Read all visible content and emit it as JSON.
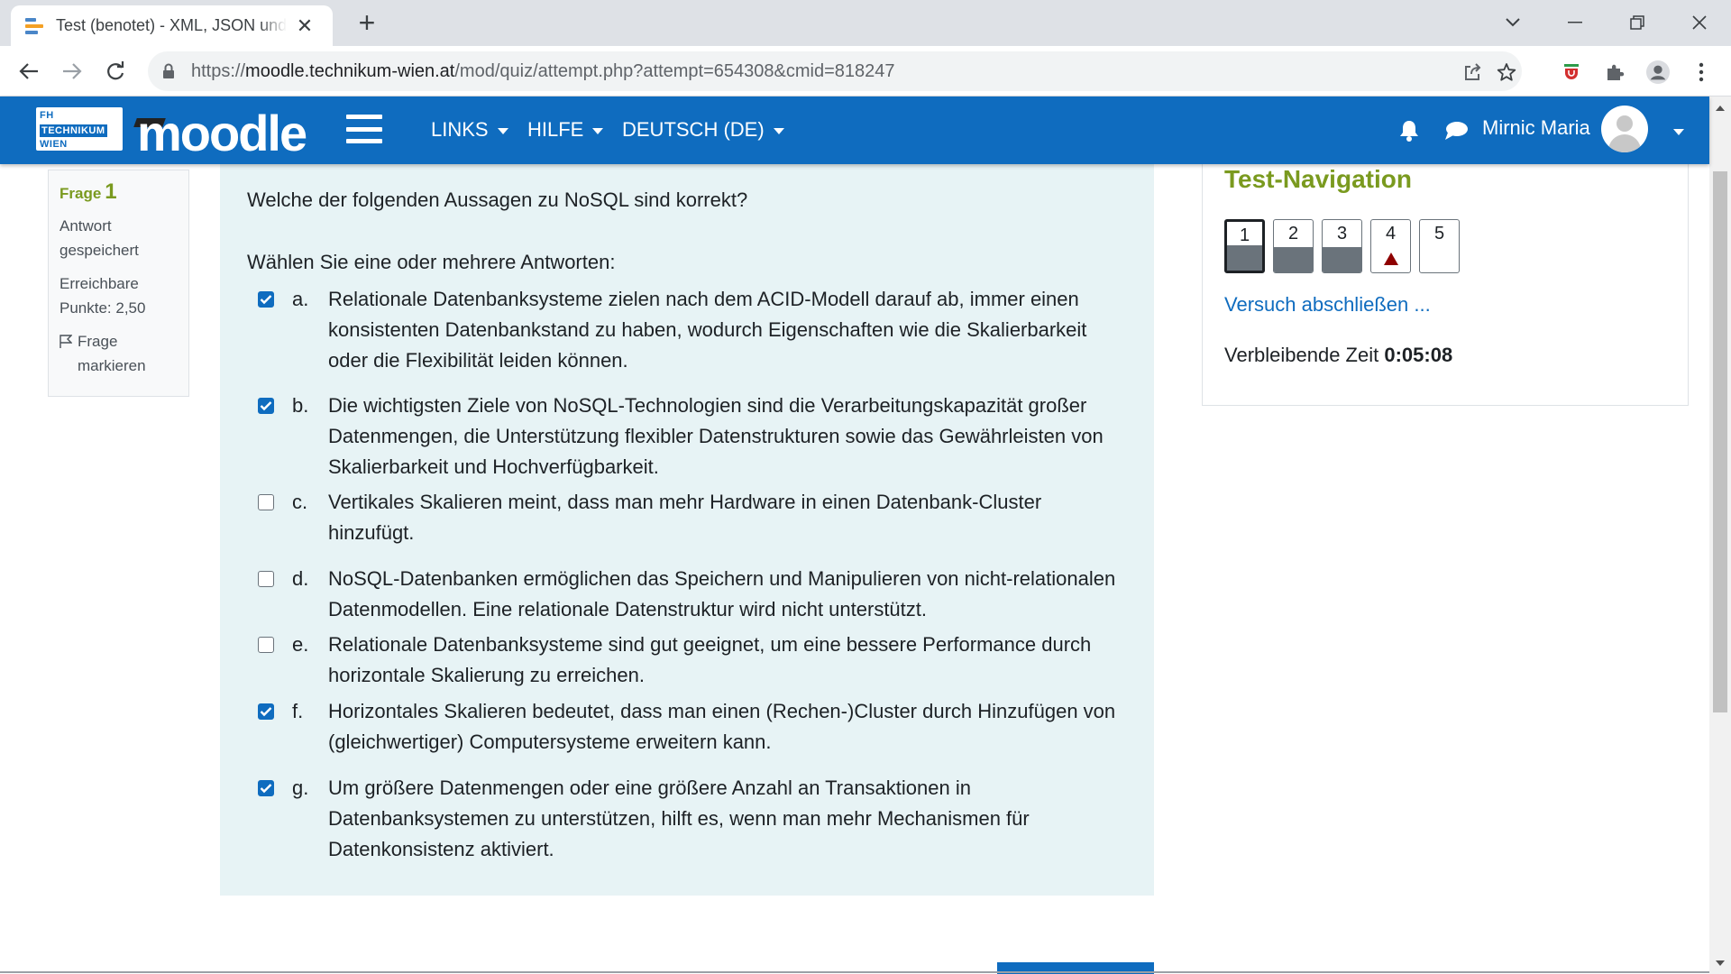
{
  "browser": {
    "tab_title": "Test (benotet) - XML, JSON und NoSQL",
    "url_prefix": "https://",
    "url_host": "moodle.technikum-wien.at",
    "url_path": "/mod/quiz/attempt.php?attempt=654308&cmid=818247"
  },
  "navbar": {
    "logo_lines": [
      "FH",
      "TECHNIKUM",
      "WIEN"
    ],
    "brand": "moodle",
    "menus": [
      "LINKS",
      "HILFE",
      "DEUTSCH (DE)"
    ],
    "user_name": "Mirnic Maria"
  },
  "question_info": {
    "label": "Frage",
    "number": "1",
    "status_1": "Antwort",
    "status_2": "gespeichert",
    "points_1": "Erreichbare",
    "points_2": "Punkte: 2,50",
    "flag_1": "Frage",
    "flag_2": "markieren"
  },
  "question": {
    "text": "Welche der folgenden Aussagen zu NoSQL sind korrekt?",
    "prompt": "Wählen Sie eine oder mehrere Antworten:",
    "answers": [
      {
        "letter": "a.",
        "checked": true,
        "text": "Relationale Datenbanksysteme zielen nach dem ACID-Modell darauf ab, immer einen konsistenten Datenbankstand zu haben, wodurch Eigenschaften wie die Skalierbarkeit oder die Flexibilität leiden können."
      },
      {
        "letter": "b.",
        "checked": true,
        "text": "Die wichtigsten Ziele von NoSQL-Technologien sind die Verarbeitungskapazität großer Datenmengen, die Unterstützung flexibler Datenstrukturen sowie das Gewährleisten von Skalierbarkeit und Hochverfügbarkeit."
      },
      {
        "letter": "c.",
        "checked": false,
        "text": "Vertikales Skalieren meint, dass man mehr Hardware in einen Datenbank-Cluster hinzufügt."
      },
      {
        "letter": "d.",
        "checked": false,
        "text": "NoSQL-Datenbanken ermöglichen das Speichern und Manipulieren von nicht-relationalen Datenmodellen. Eine relationale Datenstruktur wird nicht unterstützt."
      },
      {
        "letter": "e.",
        "checked": false,
        "text": "Relationale Datenbanksysteme sind gut geeignet, um eine bessere Performance durch horizontale Skalierung zu erreichen."
      },
      {
        "letter": "f.",
        "checked": true,
        "text": "Horizontales Skalieren bedeutet, dass man einen (Rechen-)Cluster durch Hinzufügen von (gleichwertiger) Computersysteme erweitern kann."
      },
      {
        "letter": "g.",
        "checked": true,
        "text": "Um größere Datenmengen oder eine größere Anzahl an Transaktionen in Datenbanksystemen zu unterstützen, hilft es, wenn man mehr Mechanismen für Datenkonsistenz aktiviert."
      }
    ]
  },
  "test_navigation": {
    "title": "Test-Navigation",
    "questions": [
      {
        "n": "1",
        "state": "answered",
        "current": true
      },
      {
        "n": "2",
        "state": "answered",
        "current": false
      },
      {
        "n": "3",
        "state": "answered",
        "current": false
      },
      {
        "n": "4",
        "state": "flagged",
        "current": false
      },
      {
        "n": "5",
        "state": "empty",
        "current": false
      }
    ],
    "finish_link": "Versuch abschließen ...",
    "time_label": "Verbleibende Zeit",
    "time_value": "0:05:08"
  },
  "colors": {
    "brand_blue": "#0f6cbf",
    "question_bg": "#e7f3f5",
    "accent_green": "#7a9a1f",
    "flag_red": "#8e0000"
  }
}
